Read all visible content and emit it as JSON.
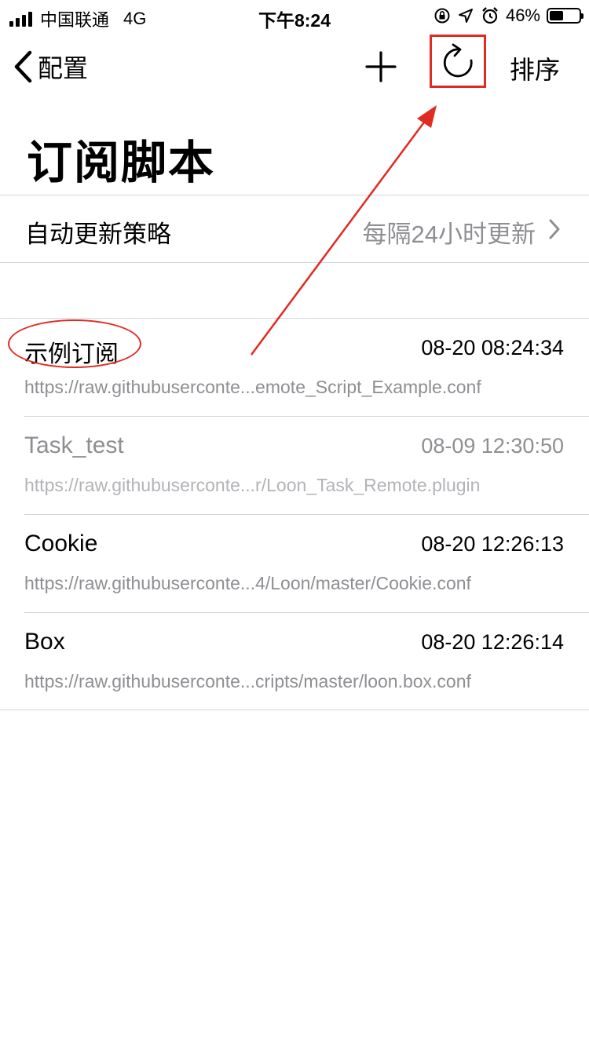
{
  "status_bar": {
    "carrier": "中国联通",
    "network": "4G",
    "time": "下午8:24",
    "battery_percent": "46%",
    "battery_level": 0.46
  },
  "nav": {
    "back_label": "配置",
    "add_icon": "plus-icon",
    "refresh_icon": "refresh-icon",
    "sort_label": "排序"
  },
  "page": {
    "title": "订阅脚本"
  },
  "update_policy": {
    "label": "自动更新策略",
    "value": "每隔24小时更新"
  },
  "subscriptions": [
    {
      "name": "示例订阅",
      "time": "08-20 08:24:34",
      "url": "https://raw.githubuserconte...emote_Script_Example.conf",
      "enabled": true
    },
    {
      "name": "Task_test",
      "time": "08-09 12:30:50",
      "url": "https://raw.githubuserconte...r/Loon_Task_Remote.plugin",
      "enabled": false
    },
    {
      "name": "Cookie",
      "time": "08-20 12:26:13",
      "url": "https://raw.githubuserconte...4/Loon/master/Cookie.conf",
      "enabled": true
    },
    {
      "name": "Box",
      "time": "08-20 12:26:14",
      "url": "https://raw.githubuserconte...cripts/master/loon.box.conf",
      "enabled": true
    }
  ],
  "annotation_color": "#e02a22"
}
